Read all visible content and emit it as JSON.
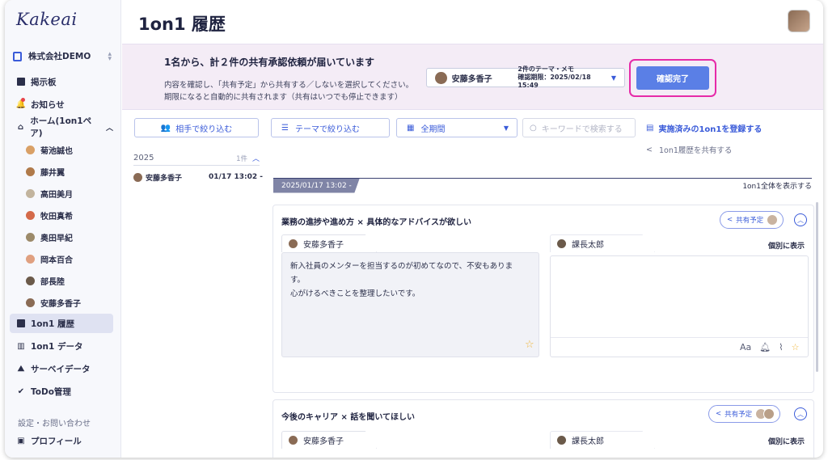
{
  "app": {
    "logo": "Kakeai",
    "company": "株式会社DEMO"
  },
  "sidebar": {
    "nav": [
      {
        "label": "掲示板"
      },
      {
        "label": "お知らせ"
      },
      {
        "label": "ホーム(1on1ペア)"
      }
    ],
    "pairs": [
      "菊池誠也",
      "藤井翼",
      "高田美月",
      "牧田真希",
      "奥田早紀",
      "岡本百合",
      "部長陸",
      "安藤多香子"
    ],
    "lower_nav": [
      {
        "label": "1on1 履歴",
        "active": true
      },
      {
        "label": "1on1 データ"
      },
      {
        "label": "サーベイデータ"
      },
      {
        "label": "ToDo管理"
      }
    ],
    "footer_link": "設定・お問い合わせ",
    "profile": "プロフィール"
  },
  "page": {
    "title": "1on1 履歴"
  },
  "banner": {
    "title": "1名から、計２件の共有承認依頼が届いています",
    "line1": "内容を確認し、「共有予定」から共有する／しないを選択してください。",
    "line2": "期限になると自動的に共有されます（共有はいつでも停止できます）",
    "request_name": "安藤多香子",
    "request_meta1": "2件のテーマ・メモ",
    "request_meta2": "確認期限：2025/02/18 15:49",
    "confirm_label": "確認完了",
    "accent": "#e62ba8"
  },
  "filters": {
    "partner": "相手で絞り込む",
    "theme": "テーマで絞り込む",
    "period": "全期間",
    "search_placeholder": "キーワードで検索する",
    "register": "実施済みの1on1を登録する",
    "share": "1on1履歴を共有する"
  },
  "history": {
    "year": "2025",
    "count": "1件",
    "items": [
      {
        "name": "安藤多香子",
        "datetime": "01/17 13:02 -"
      }
    ]
  },
  "detail": {
    "date": "2025/01/17 13:02 -",
    "show_all": "1on1全体を表示する",
    "cards": [
      {
        "title": "業務の進捗や進め方 × 具体的なアドバイスが欲しい",
        "share_label": "共有予定",
        "left_name": "安藤多香子",
        "left_text": [
          "新入社員のメンターを担当するのが初めてなので、不安もありま",
          "す。",
          "心がけるべきことを整理したいです。"
        ],
        "right_name": "課長太郎",
        "right_toggle": "個別に表示"
      },
      {
        "title": "今後のキャリア × 話を聞いてほしい",
        "share_label": "共有予定",
        "left_name": "安藤多香子",
        "right_name": "課長太郎",
        "right_toggle": "個別に表示"
      }
    ]
  }
}
